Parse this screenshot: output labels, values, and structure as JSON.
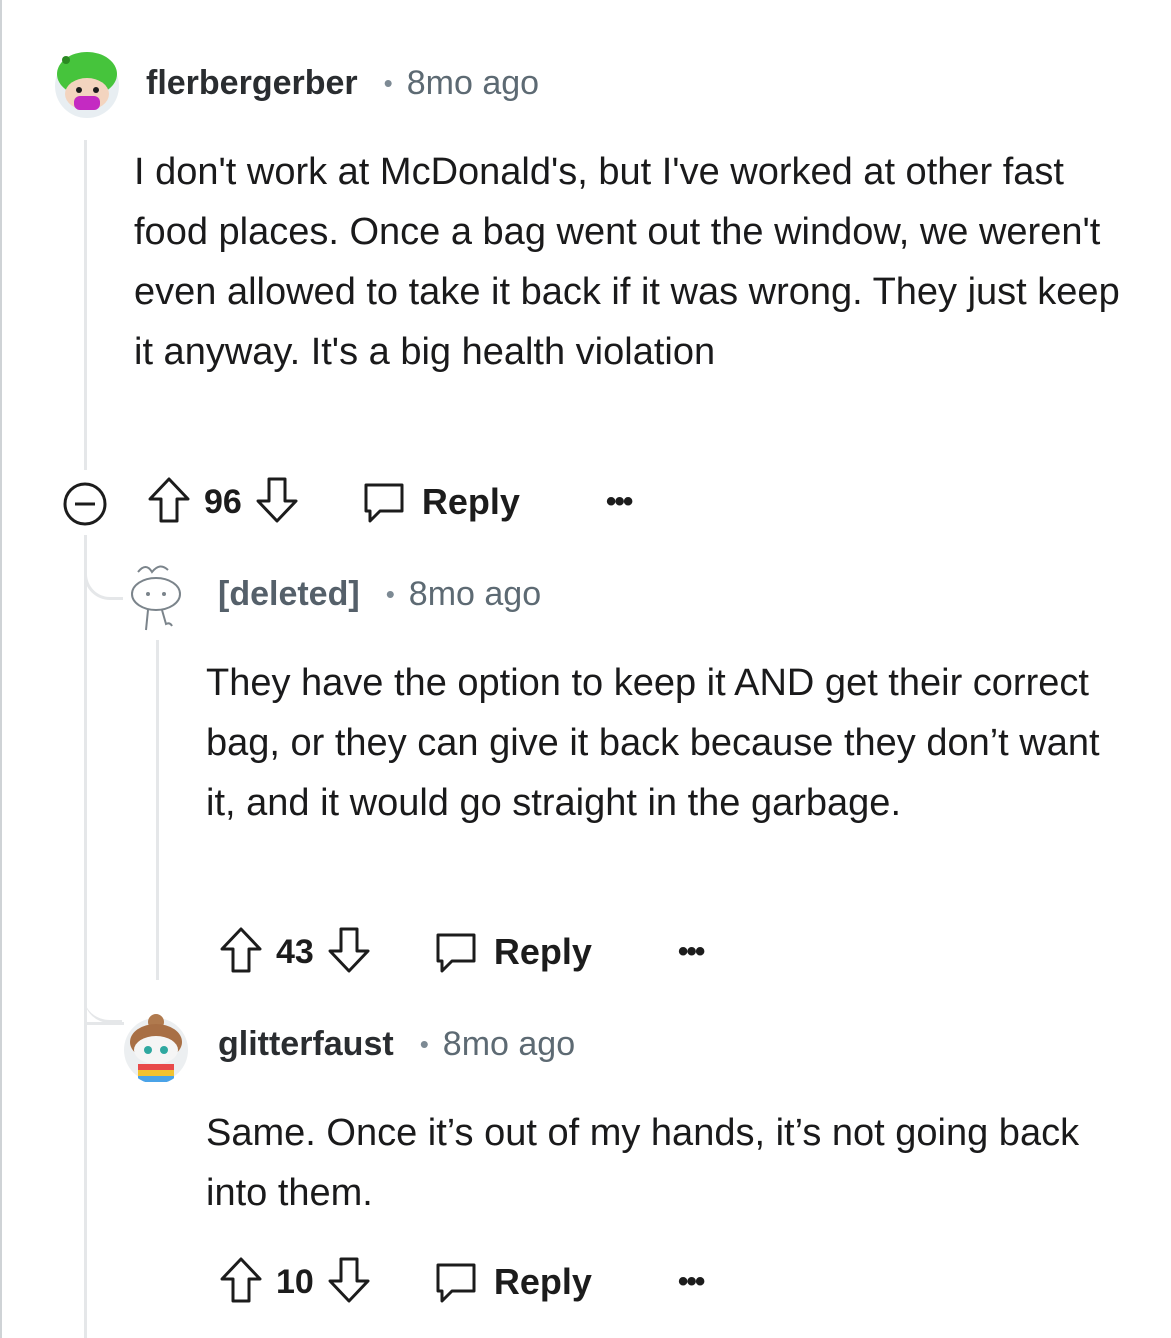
{
  "comments": [
    {
      "username": "flerbergerber",
      "separator": "•",
      "time": "8mo ago",
      "body": "I don't work at McDonald's, but I've worked at other fast food places. Once a bag went out the window, we weren't even allowed to take it back if it was wrong. They just keep it anyway. It's a big health violation",
      "score": "96",
      "reply_label": "Reply",
      "more_label": "•••",
      "avatar_icon": "snoo-avatar-green-hat-icon"
    },
    {
      "username": "[deleted]",
      "separator": "•",
      "time": "8mo ago",
      "body": "They have the option to keep it AND get their correct bag, or they can give it back because they don’t want it, and it would go straight in the garbage.",
      "score": "43",
      "reply_label": "Reply",
      "more_label": "•••",
      "avatar_icon": "deleted-user-avatar-icon"
    },
    {
      "username": "glitterfaust",
      "separator": "•",
      "time": "8mo ago",
      "body": "Same. Once it’s out of my hands, it’s not going back into them.",
      "score": "10",
      "reply_label": "Reply",
      "more_label": "•••",
      "avatar_icon": "snoo-avatar-rainbow-icon"
    }
  ],
  "colors": {
    "thread_line": "#e5e7e9",
    "meta_text": "#5d6a73",
    "body_text": "#1a1a1b"
  }
}
